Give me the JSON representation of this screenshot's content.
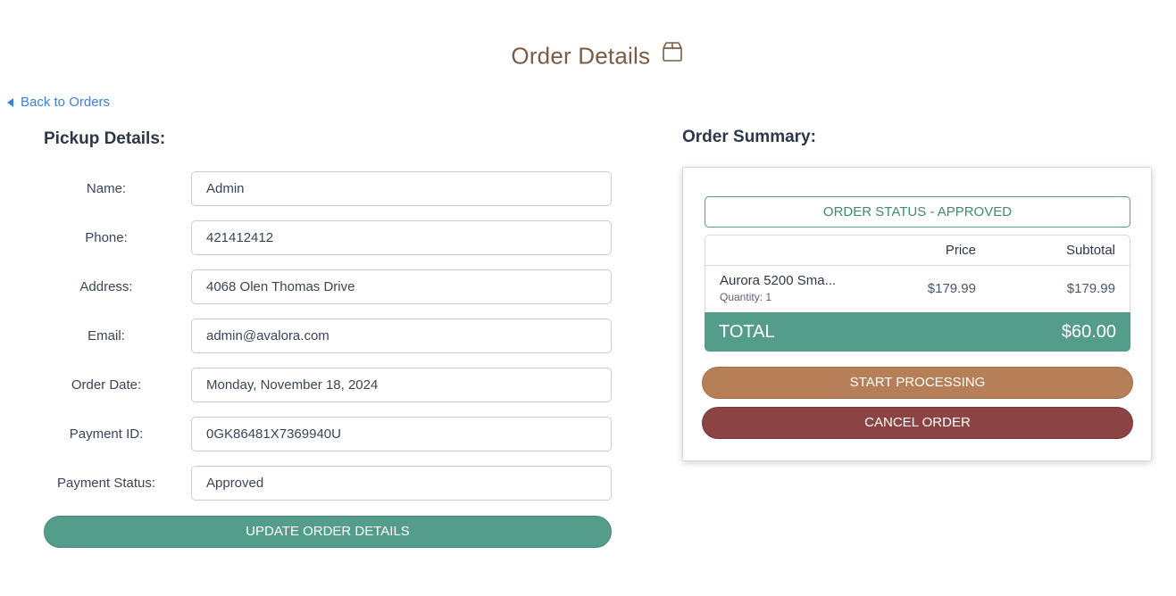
{
  "header": {
    "title": "Order Details",
    "title_icon": "box-icon",
    "back_link": "Back to Orders"
  },
  "pickup": {
    "heading": "Pickup Details:",
    "fields": [
      {
        "label": "Name:",
        "value": "Admin"
      },
      {
        "label": "Phone:",
        "value": "421412412"
      },
      {
        "label": "Address:",
        "value": "4068 Olen Thomas Drive"
      },
      {
        "label": "Email:",
        "value": "admin@avalora.com"
      },
      {
        "label": "Order Date:",
        "value": "Monday, November 18, 2024"
      },
      {
        "label": "Payment ID:",
        "value": "0GK86481X7369940U"
      },
      {
        "label": "Payment Status:",
        "value": "Approved"
      }
    ],
    "update_button": "UPDATE ORDER DETAILS"
  },
  "summary": {
    "heading": "Order Summary:",
    "status": "ORDER STATUS - APPROVED",
    "columns": {
      "price": "Price",
      "subtotal": "Subtotal"
    },
    "items": [
      {
        "name": "Aurora 5200 Sma...",
        "quantity": "Quantity: 1",
        "price": "$179.99",
        "subtotal": "$179.99"
      }
    ],
    "total_label": "TOTAL",
    "total_value": "$60.00",
    "start_processing": "START PROCESSING",
    "cancel_order": "CANCEL ORDER"
  },
  "colors": {
    "accent_green": "#539d8a",
    "process_brown": "#b67f58",
    "cancel_red": "#8c4343",
    "title_brown": "#7a5c44",
    "link_blue": "#3b82d6"
  }
}
